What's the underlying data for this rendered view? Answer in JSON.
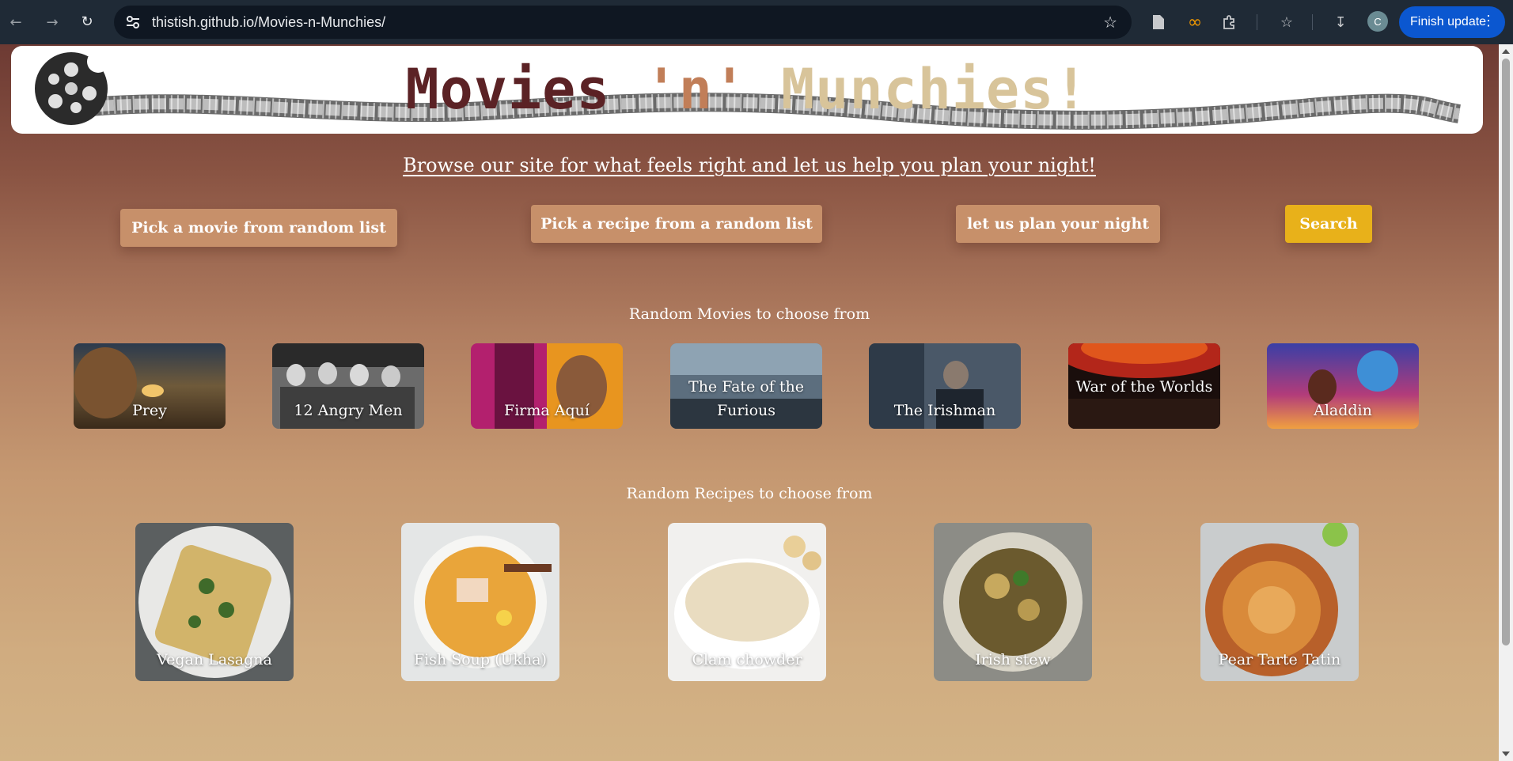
{
  "browser": {
    "url": "thistish.github.io/Movies-n-Munchies/",
    "avatar_initial": "C",
    "finish_update_label": "Finish update"
  },
  "header": {
    "title_part1": "Movies",
    "title_part2": "'n'",
    "title_part3": "Munchies!"
  },
  "tagline": "Browse our site for what feels right and let us help you plan your night!",
  "buttons": {
    "random_movie": "Pick a movie from random list",
    "random_recipe": "Pick a recipe from a random list",
    "plan_night": "let us plan your night",
    "search": "Search"
  },
  "movies": {
    "heading": "Random Movies to choose from",
    "items": [
      {
        "title": "Prey"
      },
      {
        "title": "12 Angry Men"
      },
      {
        "title": "Firma Aquí"
      },
      {
        "title": "The Fate of the Furious"
      },
      {
        "title": "The Irishman"
      },
      {
        "title": "War of the Worlds"
      },
      {
        "title": "Aladdin"
      }
    ]
  },
  "recipes": {
    "heading": "Random Recipes to choose from",
    "items": [
      {
        "title": "Vegan Lasagna"
      },
      {
        "title": "Fish Soup (Ukha)"
      },
      {
        "title": "Clam chowder"
      },
      {
        "title": "Irish stew"
      },
      {
        "title": "Pear Tarte Tatin"
      }
    ]
  },
  "colors": {
    "title_dark": "#5b2225",
    "title_mid": "#c17e58",
    "title_light": "#d8c49a",
    "button": "#c7906a",
    "search_button": "#e8b11a"
  }
}
